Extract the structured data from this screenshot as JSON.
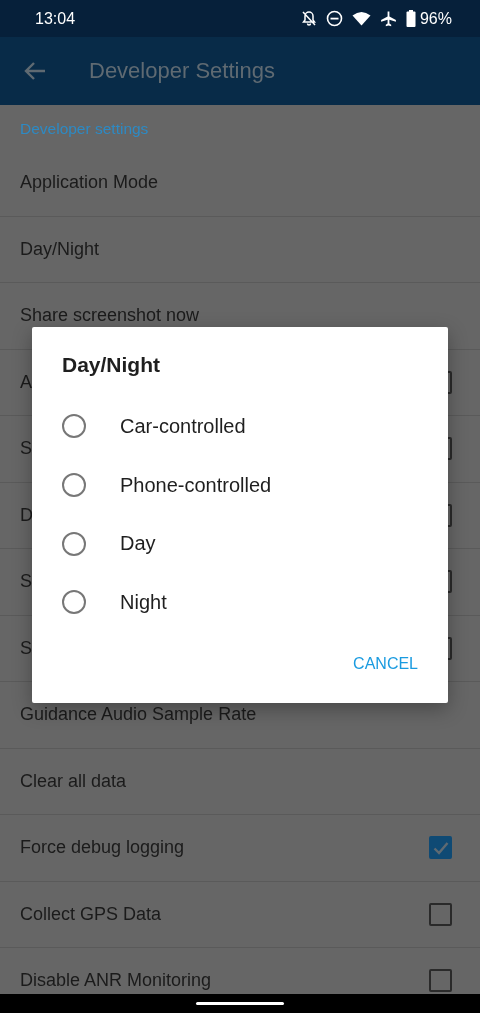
{
  "status_bar": {
    "time": "13:04",
    "battery": "96%"
  },
  "app_bar": {
    "title": "Developer Settings"
  },
  "section": "Developer settings",
  "items": [
    {
      "label": "Application Mode",
      "kind": "plain"
    },
    {
      "label": "Day/Night",
      "kind": "plain"
    },
    {
      "label": "Share screenshot now",
      "kind": "plain"
    },
    {
      "label": "A",
      "kind": "checkbox",
      "checked": false
    },
    {
      "label": "S",
      "kind": "checkbox",
      "checked": false
    },
    {
      "label": "D",
      "kind": "checkbox",
      "checked": false
    },
    {
      "label": "S",
      "kind": "checkbox",
      "checked": false
    },
    {
      "label": "S",
      "kind": "checkbox",
      "checked": false
    },
    {
      "label": "Guidance Audio Sample Rate",
      "kind": "plain"
    },
    {
      "label": "Clear all data",
      "kind": "plain"
    },
    {
      "label": "Force debug logging",
      "kind": "checkbox",
      "checked": true
    },
    {
      "label": "Collect GPS Data",
      "kind": "checkbox",
      "checked": false
    },
    {
      "label": "Disable ANR Monitoring",
      "kind": "checkbox",
      "checked": false
    }
  ],
  "dialog": {
    "title": "Day/Night",
    "options": [
      {
        "label": "Car-controlled",
        "selected": false
      },
      {
        "label": "Phone-controlled",
        "selected": false
      },
      {
        "label": "Day",
        "selected": false
      },
      {
        "label": "Night",
        "selected": false
      }
    ],
    "cancel": "CANCEL"
  }
}
